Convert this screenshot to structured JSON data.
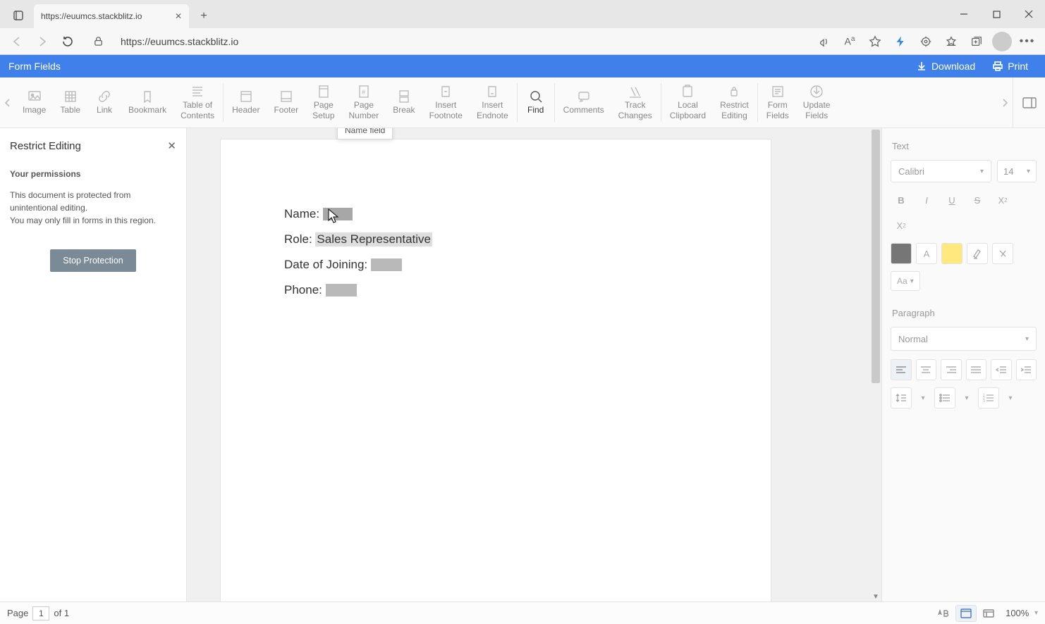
{
  "browser": {
    "tab_title": "https://euumcs.stackblitz.io",
    "url": "https://euumcs.stackblitz.io"
  },
  "app": {
    "title": "Form Fields",
    "download": "Download",
    "print": "Print"
  },
  "ribbon": {
    "items": [
      {
        "label": "Image"
      },
      {
        "label": "Table"
      },
      {
        "label": "Link"
      },
      {
        "label": "Bookmark"
      },
      {
        "label": "Table of\nContents"
      },
      {
        "label": "Header"
      },
      {
        "label": "Footer"
      },
      {
        "label": "Page\nSetup"
      },
      {
        "label": "Page\nNumber"
      },
      {
        "label": "Break"
      },
      {
        "label": "Insert\nFootnote"
      },
      {
        "label": "Insert\nEndnote"
      },
      {
        "label": "Find"
      },
      {
        "label": "Comments"
      },
      {
        "label": "Track\nChanges"
      },
      {
        "label": "Local\nClipboard"
      },
      {
        "label": "Restrict\nEditing"
      },
      {
        "label": "Form\nFields"
      },
      {
        "label": "Update\nFields"
      }
    ]
  },
  "left_panel": {
    "title": "Restrict Editing",
    "permissions_label": "Your permissions",
    "line1": "This document is protected from unintentional editing.",
    "line2": "You may only fill in forms in this region.",
    "button": "Stop Protection"
  },
  "document": {
    "tooltip": "Name field",
    "name_label": "Name:",
    "role_label": "Role:",
    "role_value": "Sales Representative",
    "doj_label": "Date of Joining:",
    "phone_label": "Phone:"
  },
  "right_panel": {
    "text_section": "Text",
    "font": "Calibri",
    "size": "14",
    "case": "Aa",
    "para_section": "Paragraph",
    "style": "Normal"
  },
  "status": {
    "page_label": "Page",
    "page_current": "1",
    "of": "of",
    "page_total": "1",
    "zoom": "100%"
  }
}
